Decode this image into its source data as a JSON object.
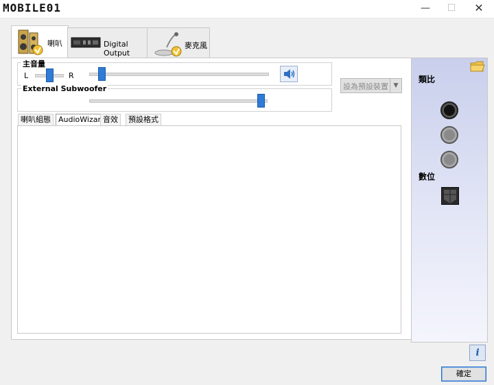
{
  "window": {
    "logo_text": "MOBILE01",
    "minimize_glyph": "—",
    "maximize_glyph": "☐",
    "close_glyph": "✕"
  },
  "device_tabs": [
    {
      "label": "喇叭",
      "icon": "speaker-icon",
      "active": true
    },
    {
      "label": "Digital Output",
      "icon": "digital-output-icon",
      "active": false
    },
    {
      "label": "麥克風",
      "icon": "microphone-icon",
      "active": false
    }
  ],
  "main_volume": {
    "label": "主音量",
    "left_label": "L",
    "right_label": "R",
    "balance_level": 0.5,
    "volume_level": 0.05
  },
  "subwoofer": {
    "label": "External Subwoofer",
    "level": 0.98
  },
  "default_device_button": "設為預設裝置",
  "sub_tabs": [
    {
      "label": "喇叭組態",
      "active": false
    },
    {
      "label": "AudioWizard",
      "active": true
    },
    {
      "label": "音效",
      "active": false
    },
    {
      "label": "預設格式",
      "active": false
    }
  ],
  "right_panel": {
    "analog_label": "類比",
    "digital_label": "數位"
  },
  "ok_button": "確定",
  "colors": {
    "accent": "#2f7bd6",
    "panel_gradient_top": "#c9cfec"
  }
}
